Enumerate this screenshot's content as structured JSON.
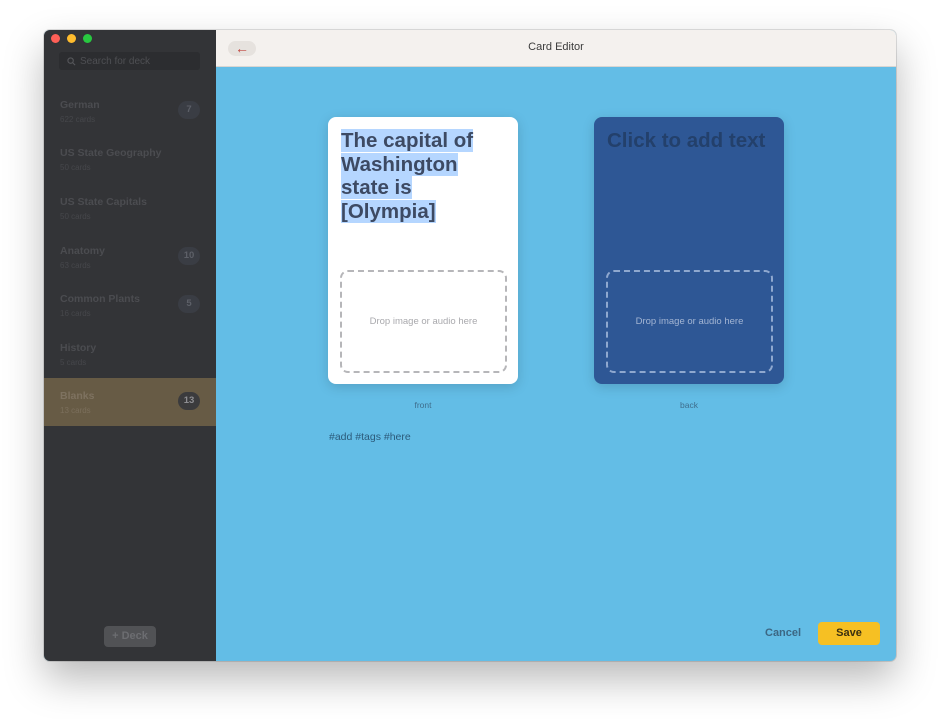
{
  "window": {
    "title": "Card Editor"
  },
  "sidebar": {
    "search_placeholder": "Search for deck",
    "decks": [
      {
        "name": "German",
        "count": "622 cards",
        "badge": "7",
        "selected": false
      },
      {
        "name": "US State Geography",
        "count": "50 cards",
        "badge": "",
        "selected": false
      },
      {
        "name": "US State Capitals",
        "count": "50 cards",
        "badge": "",
        "selected": false
      },
      {
        "name": "Anatomy",
        "count": "63 cards",
        "badge": "10",
        "selected": false
      },
      {
        "name": "Common Plants",
        "count": "16 cards",
        "badge": "5",
        "selected": false
      },
      {
        "name": "History",
        "count": "5 cards",
        "badge": "",
        "selected": false
      },
      {
        "name": "Blanks",
        "count": "13 cards",
        "badge": "13",
        "selected": true
      }
    ],
    "add_deck_label": "+ Deck"
  },
  "toolbar": {
    "back_icon": "←"
  },
  "editor": {
    "front": {
      "text": "The capital of Washington state is [Olympia]",
      "drop_text": "Drop image or audio here",
      "label": "front"
    },
    "back": {
      "placeholder": "Click to add text",
      "drop_text": "Drop image or audio here",
      "label": "back"
    },
    "tags_placeholder": "#add #tags #here"
  },
  "actions": {
    "cancel_label": "Cancel",
    "save_label": "Save"
  },
  "colors": {
    "accent_save": "#f6c023",
    "editor_bg": "#63bde6",
    "back_card": "#2e5795",
    "selection_highlight": "#b5d6ff",
    "traffic_red": "#fe5f57",
    "traffic_yellow": "#febc2e",
    "traffic_green": "#28c840"
  }
}
